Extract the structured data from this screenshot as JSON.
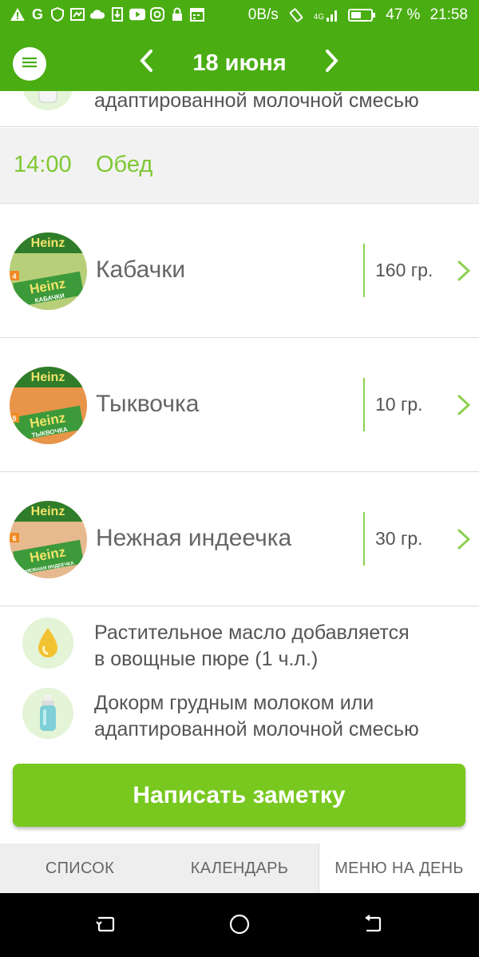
{
  "status_bar": {
    "left_icons": [
      "warning-icon",
      "g-icon",
      "shield-icon",
      "screenshot-icon",
      "cloud-icon",
      "download-icon",
      "youtube-icon",
      "instagram-icon",
      "lock-icon",
      "calendar-icon"
    ],
    "net_speed": "0B/s",
    "network": "4G",
    "battery": "47 %",
    "time": "21:58"
  },
  "header": {
    "date": "18 июня",
    "prev_icon": "chevron-left-icon",
    "next_icon": "chevron-right-icon",
    "menu_icon": "hamburger-icon"
  },
  "top_partial_note": {
    "text": "адаптированной молочной смесью",
    "icon": "baby-bottle-icon"
  },
  "meal": {
    "time": "14:00",
    "name": "Обед"
  },
  "foods": [
    {
      "name": "Кабачки",
      "qty": "160 гр.",
      "brand": "Heinz",
      "label": "КАБАЧКИ",
      "age": "4",
      "color": "#b8cf7a"
    },
    {
      "name": "Тыквочка",
      "qty": "10 гр.",
      "brand": "Heinz",
      "label": "ТЫКВОЧКА",
      "age": "5",
      "color": "#e8954a"
    },
    {
      "name": "Нежная индеечка",
      "qty": "30 гр.",
      "brand": "Heinz",
      "label": "НЕЖНАЯ ИНДЕЕЧКА",
      "age": "6",
      "color": "#e7b98e"
    }
  ],
  "notes": [
    {
      "text_line1": "Растительное масло добавляется",
      "text_line2": "в овощные пюре (1 ч.л.)",
      "icon": "oil-drop-icon"
    },
    {
      "text_line1": "Докорм грудным молоком или",
      "text_line2": "адаптированной молочной смесью",
      "icon": "baby-bottle-icon"
    }
  ],
  "cta": {
    "label": "Написать заметку"
  },
  "tabs": [
    {
      "label": "СПИСОК",
      "active": false
    },
    {
      "label": "КАЛЕНДАРЬ",
      "active": false
    },
    {
      "label": "МЕНЮ НА ДЕНЬ",
      "active": true
    }
  ],
  "colors": {
    "accent_green": "#4aad12",
    "button_green": "#78c81f",
    "label_green": "#7ec832"
  }
}
